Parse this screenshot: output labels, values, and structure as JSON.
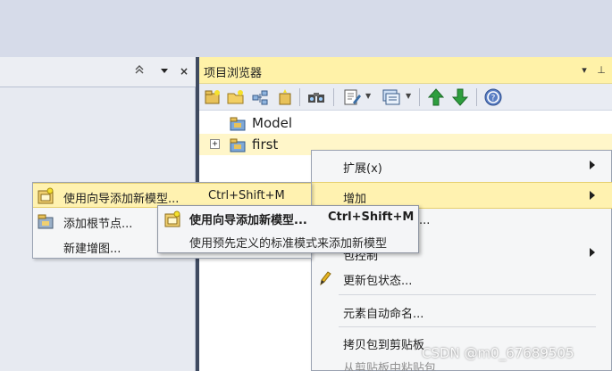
{
  "left_panel": {
    "buttons": {
      "collapse_icon": "double-chevron-up-icon",
      "dropdown_icon": "chevron-down-icon",
      "close_label": "×"
    }
  },
  "project_browser": {
    "title": "项目浏览器",
    "title_buttons": {
      "dropdown": "▾",
      "pin": "⊥"
    },
    "toolbar_icons": [
      "new-package-icon",
      "new-folder-icon",
      "new-diagram-icon",
      "new-element-icon",
      "find-icon",
      "edit-icon",
      "view-icon",
      "move-up-icon",
      "move-down-icon",
      "help-icon"
    ],
    "tree": [
      {
        "label": "Model",
        "expander": ""
      },
      {
        "label": "first",
        "expander": "+"
      }
    ]
  },
  "context_menu": {
    "items": [
      {
        "label": "扩展(x)",
        "submenu": true
      },
      {
        "label": "增加",
        "submenu": true,
        "highlighted": true
      },
      {
        "label": "...",
        "partial": true
      },
      {
        "label": "包控制",
        "submenu": true
      },
      {
        "label": "更新包状态...",
        "icon": "pencil-icon"
      },
      {
        "label": "元素自动命名..."
      },
      {
        "label": "拷贝包到剪贴板"
      },
      {
        "label": "从剪贴板中粘贴包",
        "disabled": true
      }
    ]
  },
  "add_submenu": {
    "items": [
      {
        "label": "使用向导添加新模型...",
        "shortcut": "Ctrl+Shift+M",
        "icon": "wizard-model-icon",
        "highlighted": true
      },
      {
        "label": "添加根节点...",
        "icon": "root-node-icon"
      },
      {
        "label": "新建增图...",
        "icon": ""
      }
    ]
  },
  "tooltip": {
    "title": "使用向导添加新模型...",
    "shortcut": "Ctrl+Shift+M",
    "description": "使用预先定义的标准模式来添加新模型"
  },
  "watermark": "CSDN @m0_67689505",
  "colors": {
    "highlight": "#fff2b0",
    "title_bar": "#fff2a8",
    "accent_green": "#2e9e3e"
  }
}
